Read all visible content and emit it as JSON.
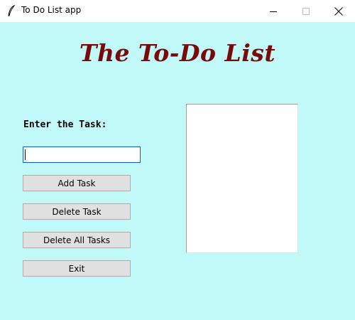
{
  "window": {
    "title": "To Do List app",
    "icon": "feather-icon"
  },
  "app": {
    "heading": "The To-Do List",
    "heading_color": "#7a0a0a",
    "background_color": "#c1f9f9",
    "task_label": "Enter the Task:",
    "task_input_value": "",
    "buttons": {
      "add": "Add Task",
      "delete": "Delete Task",
      "delete_all": "Delete All Tasks",
      "exit": "Exit"
    },
    "tasks": []
  }
}
